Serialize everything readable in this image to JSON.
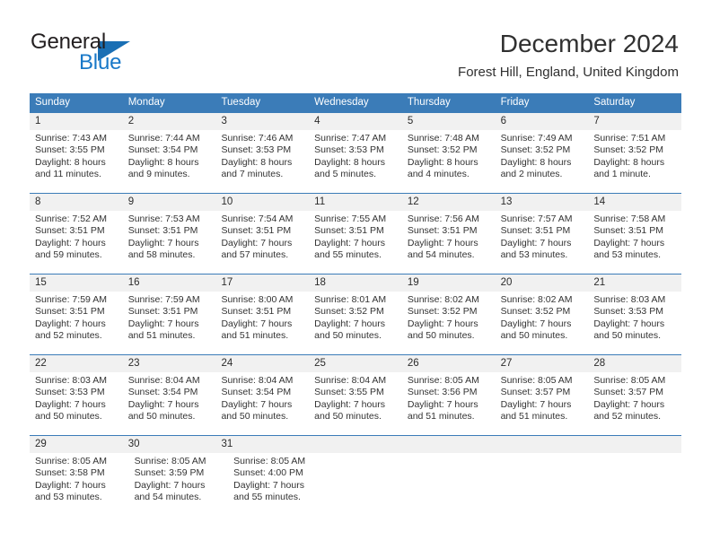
{
  "logo": {
    "primary_text": "General",
    "secondary_text": "Blue",
    "primary_color": "#231f20",
    "secondary_color": "#1878c8",
    "triangle_color": "#1a6fb4"
  },
  "header": {
    "title": "December 2024",
    "subtitle": "Forest Hill, England, United Kingdom"
  },
  "theme": {
    "header_blue": "#3b7cb8",
    "daynum_band": "#f1f1f1",
    "text": "#333333"
  },
  "weekdays": [
    "Sunday",
    "Monday",
    "Tuesday",
    "Wednesday",
    "Thursday",
    "Friday",
    "Saturday"
  ],
  "weeks": [
    {
      "days": [
        {
          "num": "1",
          "sunrise": "Sunrise: 7:43 AM",
          "sunset": "Sunset: 3:55 PM",
          "daylight": "Daylight: 8 hours and 11 minutes."
        },
        {
          "num": "2",
          "sunrise": "Sunrise: 7:44 AM",
          "sunset": "Sunset: 3:54 PM",
          "daylight": "Daylight: 8 hours and 9 minutes."
        },
        {
          "num": "3",
          "sunrise": "Sunrise: 7:46 AM",
          "sunset": "Sunset: 3:53 PM",
          "daylight": "Daylight: 8 hours and 7 minutes."
        },
        {
          "num": "4",
          "sunrise": "Sunrise: 7:47 AM",
          "sunset": "Sunset: 3:53 PM",
          "daylight": "Daylight: 8 hours and 5 minutes."
        },
        {
          "num": "5",
          "sunrise": "Sunrise: 7:48 AM",
          "sunset": "Sunset: 3:52 PM",
          "daylight": "Daylight: 8 hours and 4 minutes."
        },
        {
          "num": "6",
          "sunrise": "Sunrise: 7:49 AM",
          "sunset": "Sunset: 3:52 PM",
          "daylight": "Daylight: 8 hours and 2 minutes."
        },
        {
          "num": "7",
          "sunrise": "Sunrise: 7:51 AM",
          "sunset": "Sunset: 3:52 PM",
          "daylight": "Daylight: 8 hours and 1 minute."
        }
      ]
    },
    {
      "days": [
        {
          "num": "8",
          "sunrise": "Sunrise: 7:52 AM",
          "sunset": "Sunset: 3:51 PM",
          "daylight": "Daylight: 7 hours and 59 minutes."
        },
        {
          "num": "9",
          "sunrise": "Sunrise: 7:53 AM",
          "sunset": "Sunset: 3:51 PM",
          "daylight": "Daylight: 7 hours and 58 minutes."
        },
        {
          "num": "10",
          "sunrise": "Sunrise: 7:54 AM",
          "sunset": "Sunset: 3:51 PM",
          "daylight": "Daylight: 7 hours and 57 minutes."
        },
        {
          "num": "11",
          "sunrise": "Sunrise: 7:55 AM",
          "sunset": "Sunset: 3:51 PM",
          "daylight": "Daylight: 7 hours and 55 minutes."
        },
        {
          "num": "12",
          "sunrise": "Sunrise: 7:56 AM",
          "sunset": "Sunset: 3:51 PM",
          "daylight": "Daylight: 7 hours and 54 minutes."
        },
        {
          "num": "13",
          "sunrise": "Sunrise: 7:57 AM",
          "sunset": "Sunset: 3:51 PM",
          "daylight": "Daylight: 7 hours and 53 minutes."
        },
        {
          "num": "14",
          "sunrise": "Sunrise: 7:58 AM",
          "sunset": "Sunset: 3:51 PM",
          "daylight": "Daylight: 7 hours and 53 minutes."
        }
      ]
    },
    {
      "days": [
        {
          "num": "15",
          "sunrise": "Sunrise: 7:59 AM",
          "sunset": "Sunset: 3:51 PM",
          "daylight": "Daylight: 7 hours and 52 minutes."
        },
        {
          "num": "16",
          "sunrise": "Sunrise: 7:59 AM",
          "sunset": "Sunset: 3:51 PM",
          "daylight": "Daylight: 7 hours and 51 minutes."
        },
        {
          "num": "17",
          "sunrise": "Sunrise: 8:00 AM",
          "sunset": "Sunset: 3:51 PM",
          "daylight": "Daylight: 7 hours and 51 minutes."
        },
        {
          "num": "18",
          "sunrise": "Sunrise: 8:01 AM",
          "sunset": "Sunset: 3:52 PM",
          "daylight": "Daylight: 7 hours and 50 minutes."
        },
        {
          "num": "19",
          "sunrise": "Sunrise: 8:02 AM",
          "sunset": "Sunset: 3:52 PM",
          "daylight": "Daylight: 7 hours and 50 minutes."
        },
        {
          "num": "20",
          "sunrise": "Sunrise: 8:02 AM",
          "sunset": "Sunset: 3:52 PM",
          "daylight": "Daylight: 7 hours and 50 minutes."
        },
        {
          "num": "21",
          "sunrise": "Sunrise: 8:03 AM",
          "sunset": "Sunset: 3:53 PM",
          "daylight": "Daylight: 7 hours and 50 minutes."
        }
      ]
    },
    {
      "days": [
        {
          "num": "22",
          "sunrise": "Sunrise: 8:03 AM",
          "sunset": "Sunset: 3:53 PM",
          "daylight": "Daylight: 7 hours and 50 minutes."
        },
        {
          "num": "23",
          "sunrise": "Sunrise: 8:04 AM",
          "sunset": "Sunset: 3:54 PM",
          "daylight": "Daylight: 7 hours and 50 minutes."
        },
        {
          "num": "24",
          "sunrise": "Sunrise: 8:04 AM",
          "sunset": "Sunset: 3:54 PM",
          "daylight": "Daylight: 7 hours and 50 minutes."
        },
        {
          "num": "25",
          "sunrise": "Sunrise: 8:04 AM",
          "sunset": "Sunset: 3:55 PM",
          "daylight": "Daylight: 7 hours and 50 minutes."
        },
        {
          "num": "26",
          "sunrise": "Sunrise: 8:05 AM",
          "sunset": "Sunset: 3:56 PM",
          "daylight": "Daylight: 7 hours and 51 minutes."
        },
        {
          "num": "27",
          "sunrise": "Sunrise: 8:05 AM",
          "sunset": "Sunset: 3:57 PM",
          "daylight": "Daylight: 7 hours and 51 minutes."
        },
        {
          "num": "28",
          "sunrise": "Sunrise: 8:05 AM",
          "sunset": "Sunset: 3:57 PM",
          "daylight": "Daylight: 7 hours and 52 minutes."
        }
      ]
    },
    {
      "days": [
        {
          "num": "29",
          "sunrise": "Sunrise: 8:05 AM",
          "sunset": "Sunset: 3:58 PM",
          "daylight": "Daylight: 7 hours and 53 minutes."
        },
        {
          "num": "30",
          "sunrise": "Sunrise: 8:05 AM",
          "sunset": "Sunset: 3:59 PM",
          "daylight": "Daylight: 7 hours and 54 minutes."
        },
        {
          "num": "31",
          "sunrise": "Sunrise: 8:05 AM",
          "sunset": "Sunset: 4:00 PM",
          "daylight": "Daylight: 7 hours and 55 minutes."
        }
      ]
    }
  ]
}
